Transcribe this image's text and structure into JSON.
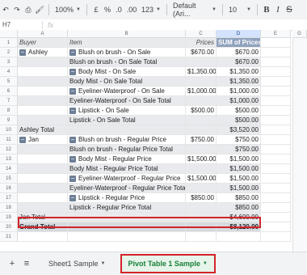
{
  "toolbar": {
    "zoom": "100%",
    "currency": "£",
    "percent": "%",
    "dec_decrease": ".0",
    "dec_increase": ".00",
    "format": "123",
    "font": "Default (Ari...",
    "size": "10",
    "bold": "B",
    "italic": "I",
    "strike": "S"
  },
  "formula_bar": {
    "cell_ref": "H7",
    "fx": "fx"
  },
  "columns": [
    "A",
    "B",
    "C",
    "D",
    "E",
    "G"
  ],
  "rows": [
    {
      "n": "1",
      "a": "Buyer",
      "b": "Item",
      "c": "Prices",
      "d": "SUM of Prices",
      "kind": "header"
    },
    {
      "n": "2",
      "a": "Ashley",
      "b": "Blush on brush - On Sale",
      "c": "$670.00",
      "d": "$670.00",
      "kind": "item",
      "a_minus": true,
      "b_minus": true
    },
    {
      "n": "3",
      "a": "",
      "b": "Blush on brush - On Sale Total",
      "c": "",
      "d": "$670.00",
      "kind": "total"
    },
    {
      "n": "4",
      "a": "",
      "b": "Body Mist - On Sale",
      "c": "$1,350.00",
      "d": "$1,350.00",
      "kind": "item",
      "b_minus": true
    },
    {
      "n": "5",
      "a": "",
      "b": "Body Mist - On Sale Total",
      "c": "",
      "d": "$1,350.00",
      "kind": "total"
    },
    {
      "n": "6",
      "a": "",
      "b": "Eyeliner-Waterproof - On Sale",
      "c": "$1,000.00",
      "d": "$1,000.00",
      "kind": "item",
      "b_minus": true
    },
    {
      "n": "7",
      "a": "",
      "b": "Eyeliner-Waterproof - On Sale Total",
      "c": "",
      "d": "$1,000.00",
      "kind": "total"
    },
    {
      "n": "8",
      "a": "",
      "b": "Lipstick - On Sale",
      "c": "$500.00",
      "d": "$500.00",
      "kind": "item",
      "b_minus": true
    },
    {
      "n": "9",
      "a": "",
      "b": "Lipstick - On Sale Total",
      "c": "",
      "d": "$500.00",
      "kind": "total"
    },
    {
      "n": "10",
      "a": "Ashley Total",
      "b": "",
      "c": "",
      "d": "$3,520.00",
      "kind": "total"
    },
    {
      "n": "11",
      "a": "Jan",
      "b": "Blush on brush - Regular Price",
      "c": "$750.00",
      "d": "$750.00",
      "kind": "item",
      "a_minus": true,
      "b_minus": true
    },
    {
      "n": "12",
      "a": "",
      "b": "Blush on brush - Regular Price Total",
      "c": "",
      "d": "$750.00",
      "kind": "total"
    },
    {
      "n": "13",
      "a": "",
      "b": "Body Mist - Regular Price",
      "c": "$1,500.00",
      "d": "$1,500.00",
      "kind": "item",
      "b_minus": true
    },
    {
      "n": "14",
      "a": "",
      "b": "Body Mist - Regular Price Total",
      "c": "",
      "d": "$1,500.00",
      "kind": "total"
    },
    {
      "n": "15",
      "a": "",
      "b": "Eyeliner-Waterproof - Regular Price",
      "c": "$1,500.00",
      "d": "$1,500.00",
      "kind": "item",
      "b_minus": true
    },
    {
      "n": "16",
      "a": "",
      "b": "Eyeliner-Waterproof - Regular Price Total",
      "c": "",
      "d": "$1,500.00",
      "kind": "total"
    },
    {
      "n": "17",
      "a": "",
      "b": "Lipstick - Regular Price",
      "c": "$850.00",
      "d": "$850.00",
      "kind": "item",
      "b_minus": true
    },
    {
      "n": "18",
      "a": "",
      "b": "Lipstick - Regular Price Total",
      "c": "",
      "d": "$850.00",
      "kind": "total"
    },
    {
      "n": "19",
      "a": "Jan Total",
      "b": "",
      "c": "",
      "d": "$4,600.00",
      "kind": "total"
    },
    {
      "n": "20",
      "a": "Grand Total",
      "b": "",
      "c": "",
      "d": "$8,120.00",
      "kind": "grand"
    },
    {
      "n": "21",
      "a": "",
      "b": "",
      "c": "",
      "d": "",
      "kind": "empty"
    }
  ],
  "sheet_tabs": {
    "add": "+",
    "menu": "≡",
    "tabs": [
      {
        "label": "Sheet1 Sample",
        "active": false
      },
      {
        "label": "Pivot Table 1 Sample",
        "active": true
      }
    ]
  },
  "colors": {
    "highlight": "#d4252a",
    "active_tab": "#188038",
    "header_fill": "#8fa2bd"
  }
}
